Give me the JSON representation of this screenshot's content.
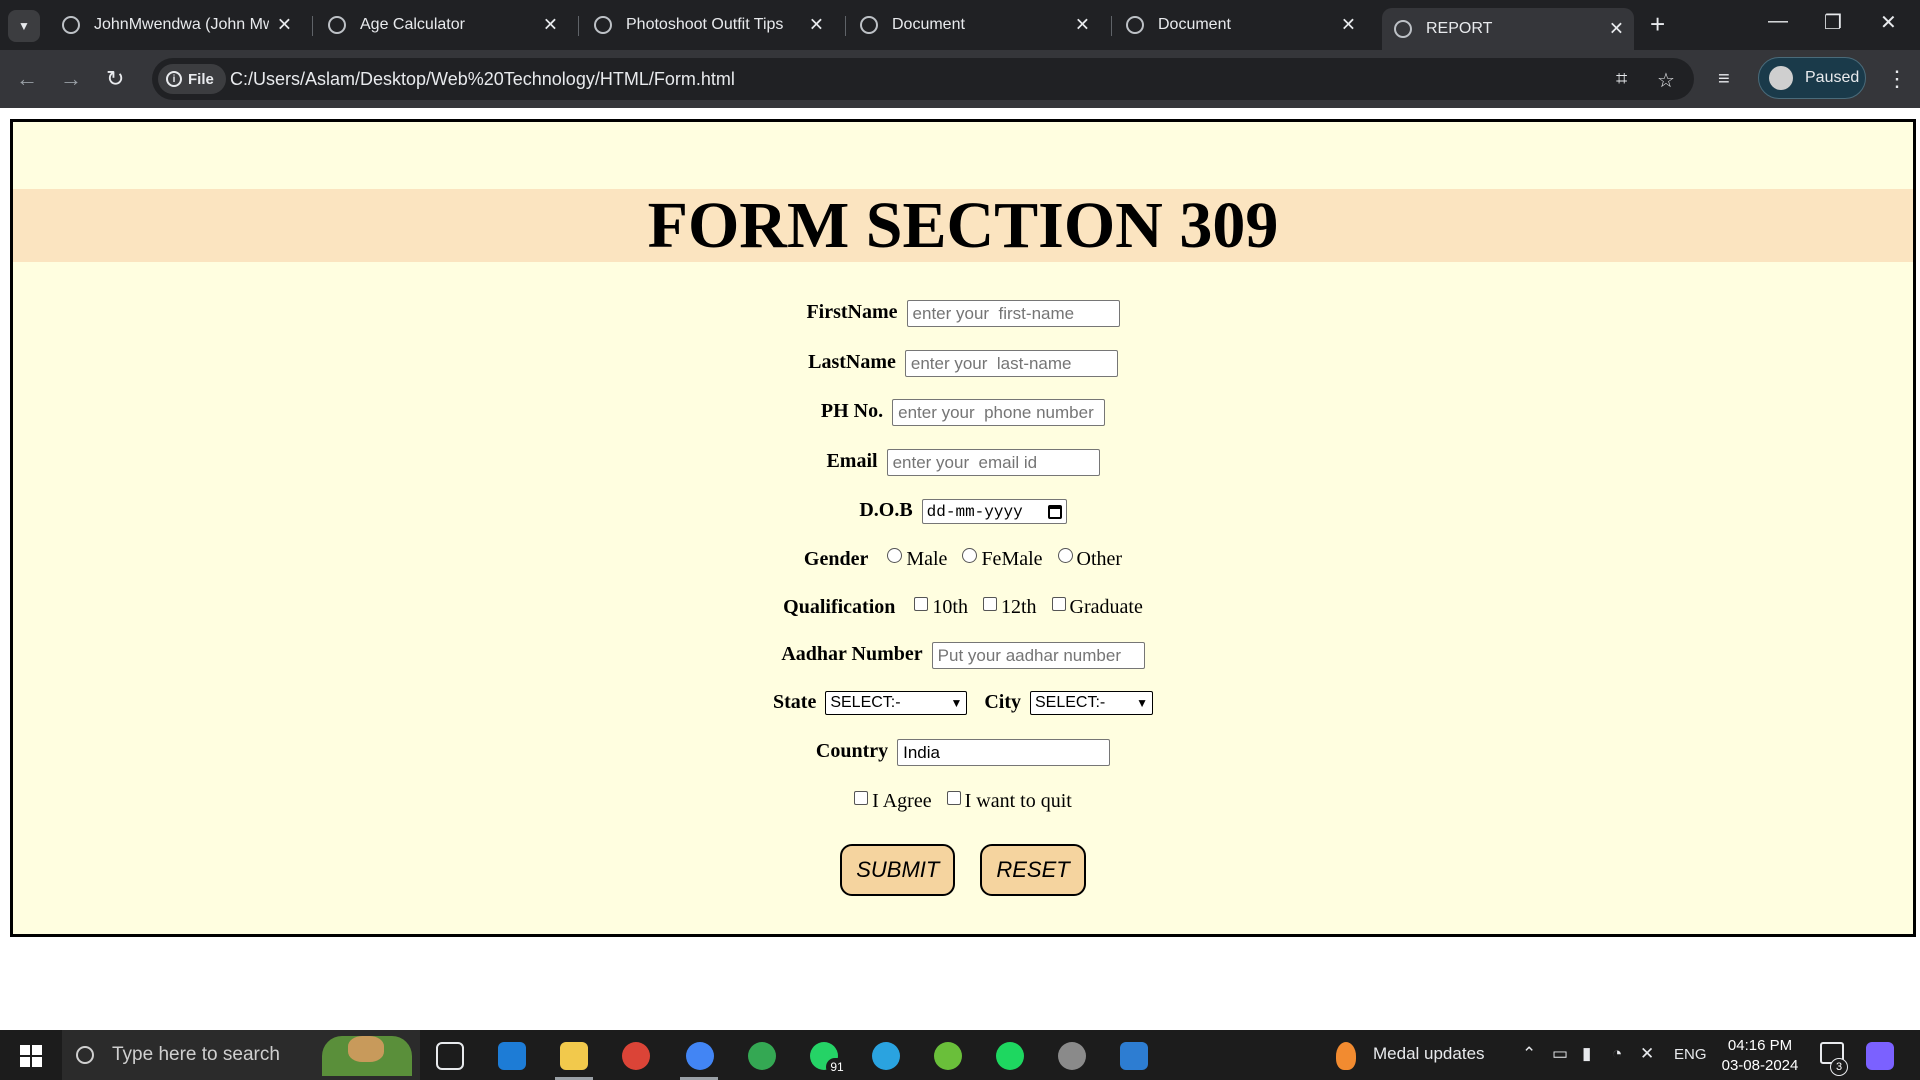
{
  "browser": {
    "tabs": [
      {
        "title": "JohnMwendwa (John Mwe",
        "active": false
      },
      {
        "title": "Age Calculator",
        "active": false
      },
      {
        "title": "Photoshoot Outfit Tips",
        "active": false
      },
      {
        "title": "Document",
        "active": false
      },
      {
        "title": "Document",
        "active": false
      },
      {
        "title": "REPORT",
        "active": true
      }
    ],
    "address": {
      "chip_label": "File",
      "url": "C:/Users/Aslam/Desktop/Web%20Technology/HTML/Form.html"
    },
    "profile_label": "Paused"
  },
  "form": {
    "title": "FORM SECTION 309",
    "first_name": {
      "label": "FirstName",
      "placeholder": "enter your  first-name"
    },
    "last_name": {
      "label": "LastName",
      "placeholder": "enter your  last-name"
    },
    "phone": {
      "label": "PH No.",
      "placeholder": "enter your  phone number"
    },
    "email": {
      "label": "Email",
      "placeholder": "enter your  email id"
    },
    "dob": {
      "label": "D.O.B",
      "value": "dd-mm-yyyy"
    },
    "gender": {
      "label": "Gender",
      "options": [
        "Male",
        "FeMale",
        "Other"
      ]
    },
    "qualification": {
      "label": "Qualification",
      "options": [
        "10th",
        "12th",
        "Graduate"
      ]
    },
    "aadhar": {
      "label": "Aadhar Number",
      "placeholder": "Put your aadhar number"
    },
    "state": {
      "label": "State",
      "selected": "SELECT:-"
    },
    "city": {
      "label": "City",
      "selected": "SELECT:-"
    },
    "country": {
      "label": "Country",
      "value": "India"
    },
    "agree_label": "I Agree",
    "quit_label": "I want to quit",
    "submit_label": "SUBMIT",
    "reset_label": "RESET"
  },
  "taskbar": {
    "search_placeholder": "Type here to search",
    "whatsapp_badge": "91",
    "medal_label": "Medal updates",
    "language": "ENG",
    "time": "04:16 PM",
    "date": "03-08-2024",
    "notification_count": "3"
  }
}
